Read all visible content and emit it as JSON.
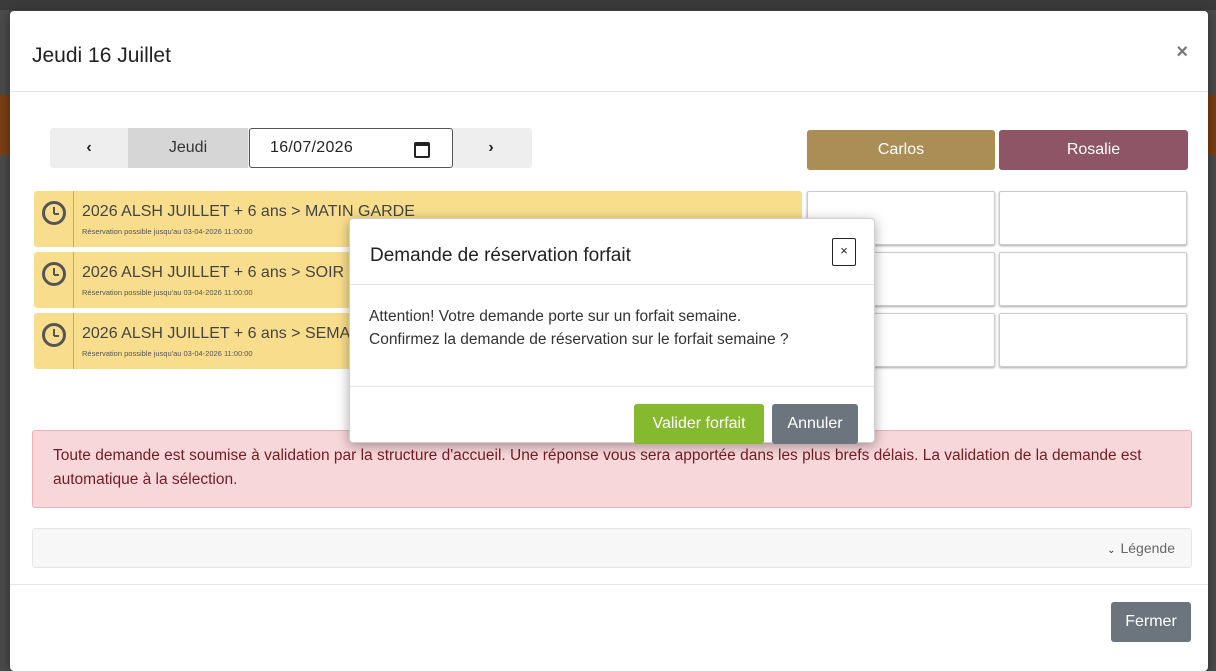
{
  "modal": {
    "title": "Jeudi 16 Juillet",
    "close_symbol": "×",
    "close_button_label": "Fermer"
  },
  "date_nav": {
    "prev_symbol": "‹",
    "next_symbol": "›",
    "day": "Jeudi",
    "date_value": "16/07/2026"
  },
  "children": [
    {
      "name": "Carlos",
      "color": "#ab8e55"
    },
    {
      "name": "Rosalie",
      "color": "#8d5565"
    }
  ],
  "activities": [
    {
      "title": "2026 ALSH JUILLET + 6 ans > MATIN GARDE",
      "subtitle": "Réservation possible jusqu'au 03-04-2026 11:00:00"
    },
    {
      "title": "2026 ALSH JUILLET + 6 ans > SOIR GARDE",
      "subtitle": "Réservation possible jusqu'au 03-04-2026 11:00:00"
    },
    {
      "title": "2026 ALSH JUILLET + 6 ans > SEMAINE",
      "subtitle": "Réservation possible jusqu'au 03-04-2026 11:00:00"
    }
  ],
  "alert": {
    "text": "Toute demande est soumise à validation par la structure d'accueil. Une réponse vous sera apportée dans les plus brefs délais. La validation de la demande est automatique à la sélection."
  },
  "legend": {
    "label": "Légende",
    "chevron": "⌄"
  },
  "dialog": {
    "title": "Demande de réservation forfait",
    "close_symbol": "×",
    "line1": "Attention! Votre demande porte sur un forfait semaine.",
    "line2": "Confirmez la demande de réservation sur le forfait semaine ?",
    "confirm_label": "Valider forfait",
    "cancel_label": "Annuler"
  },
  "colors": {
    "activity_bg": "#f8de8c",
    "alert_bg": "#f8d7da",
    "confirm_btn": "#85b92e",
    "secondary_btn": "#6c757d"
  }
}
